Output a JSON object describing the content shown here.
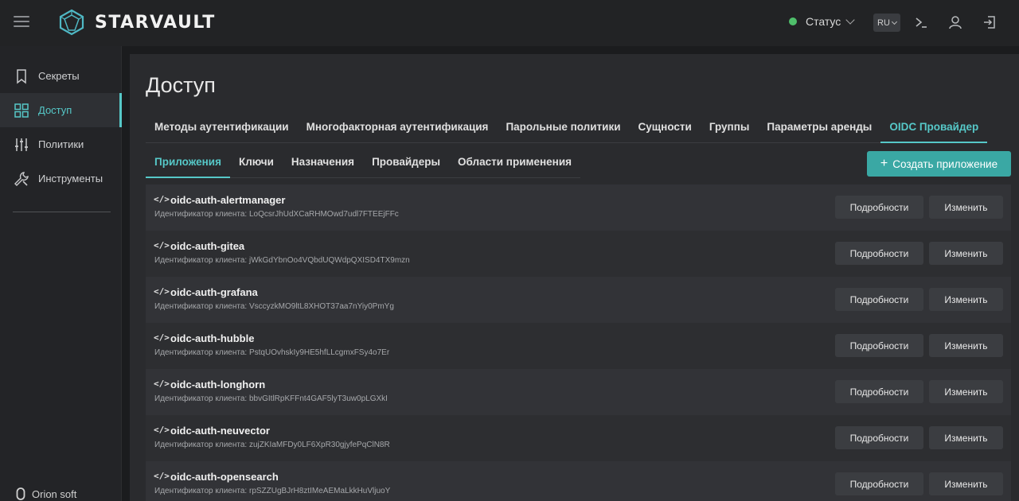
{
  "app": {
    "name": "STARVAULT",
    "status_label": "Статус",
    "status_color": "#4fbf6b",
    "language": "RU",
    "accent": "#56c8c8"
  },
  "topbar_icons": [
    "terminal-icon",
    "user-icon",
    "logout-icon"
  ],
  "sidebar": {
    "items": [
      {
        "label": "Секреты",
        "icon": "bookmark-icon",
        "active": false
      },
      {
        "label": "Доступ",
        "icon": "grid-icon",
        "active": true
      },
      {
        "label": "Политики",
        "icon": "sliders-icon",
        "active": false
      },
      {
        "label": "Инструменты",
        "icon": "tools-icon",
        "active": false
      }
    ],
    "footer": "Orion soft"
  },
  "main": {
    "title": "Доступ",
    "tabs": [
      {
        "label": "Методы аутентификации"
      },
      {
        "label": "Многофакторная аутентификация"
      },
      {
        "label": "Парольные политики"
      },
      {
        "label": "Сущности"
      },
      {
        "label": "Группы"
      },
      {
        "label": "Параметры аренды"
      },
      {
        "label": "OIDC Провайдер"
      }
    ],
    "subtabs": [
      {
        "label": "Приложения"
      },
      {
        "label": "Ключи"
      },
      {
        "label": "Назначения"
      },
      {
        "label": "Провайдеры"
      },
      {
        "label": "Области применения"
      }
    ],
    "create_button": "Создать приложение",
    "create_plus": "+",
    "client_id_label": "Идентификатор клиента:",
    "details_label": "Подробности",
    "edit_label": "Изменить",
    "code_glyph": "</>",
    "apps": [
      {
        "name": "oidc-auth-alertmanager",
        "client_id": "LoQcsrJhUdXCaRHMOwd7udl7FTEEjFFc"
      },
      {
        "name": "oidc-auth-gitea",
        "client_id": "jWkGdYbnOo4VQbdUQWdpQXISD4TX9mzn"
      },
      {
        "name": "oidc-auth-grafana",
        "client_id": "VsccyzkMO9ltL8XHOT37aa7nYiy0PmYg"
      },
      {
        "name": "oidc-auth-hubble",
        "client_id": "PstqUOvhskIy9HE5hfLLcgmxFSy4o7Er"
      },
      {
        "name": "oidc-auth-longhorn",
        "client_id": "bbvGItlRpKFFnt4GAF5lyT3uw0pLGXkI"
      },
      {
        "name": "oidc-auth-neuvector",
        "client_id": "zujZKIaMFDy0LF6XpR30gjyfePqClN8R"
      },
      {
        "name": "oidc-auth-opensearch",
        "client_id": "rpSZZUgBJrH8ztIMeAEMaLkkHuVljuoY"
      }
    ]
  }
}
